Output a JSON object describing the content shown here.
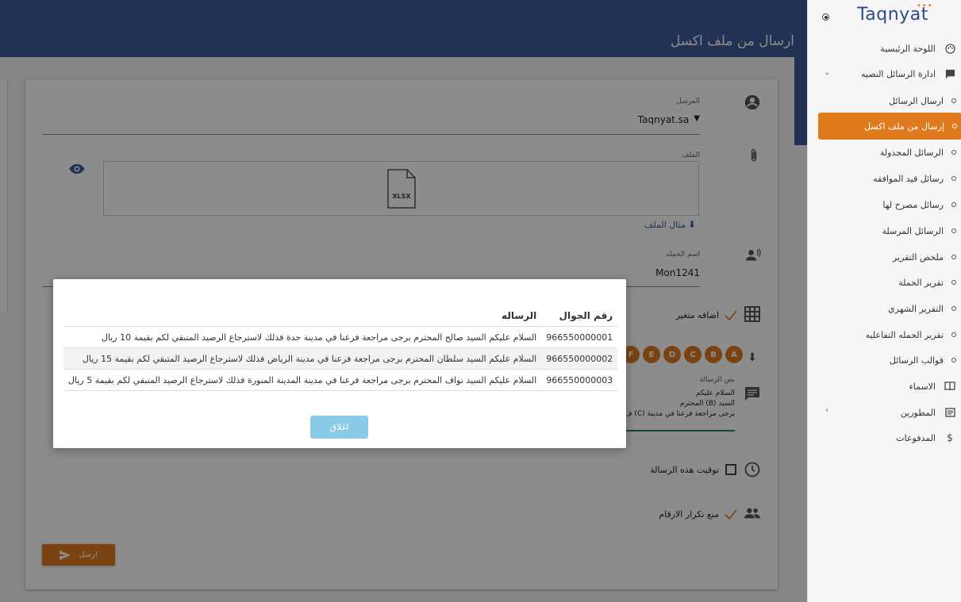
{
  "page": {
    "title": "ارسال من ملف اكسل"
  },
  "form": {
    "sender_label": "المرسل",
    "sender_value": "Taqnyat.sa",
    "file_label": "الملف",
    "file_type": "XLSX",
    "example_link": "مثال الملف",
    "campaign_label": "اسم الحمله",
    "campaign_value": "Mon1241",
    "add_variable": "اضافه متغير",
    "variables": [
      "A",
      "B",
      "C",
      "D",
      "E",
      "F"
    ],
    "message_label": "نص الرسالة",
    "message_lines": [
      "السلام عليكم",
      "السيد (B) المحترم",
      "يرجى مراجعة فرعنا في مدينة  (C) ف"
    ],
    "schedule_label": "توقيت هذه الرسالة",
    "dedupe_label": "منع تكرار الارقام",
    "send_label": "ارسل"
  },
  "dialog": {
    "col_phone": "رقم الجوال",
    "col_message": "الرساله",
    "rows": [
      {
        "phone": "966550000001",
        "message": "السلام عليكم السيد صالح المحترم برجى مراجعة فرعنا في مدينة جدة فذلك لاسترجاع الرصيد المتبقي لكم بقيمة 10 ريال"
      },
      {
        "phone": "966550000002",
        "message": "السلام عليكم السيد سلطان المحترم برجى مراجعة فرعنا في مدينة الرياض فذلك لاسترجاع الرصيد المتبقي لكم بقيمة 15 ريال"
      },
      {
        "phone": "966550000003",
        "message": "السلام عليكم السيد نواف المحترم برجى مراجعة فرعنا في مدينة المدينة المنورة فذلك لاسترجاع الرصيد المتبقي لكم بقيمة 5 ريال"
      }
    ],
    "close_label": "اغلاق"
  },
  "sidebar": {
    "brand": "Taqnyat",
    "items": [
      {
        "label": "اللوحة الرئيسية",
        "icon": "palette-icon"
      },
      {
        "label": "ادارة الرسائل النصيه",
        "icon": "message-icon"
      },
      {
        "label": "ارسال الرسائل",
        "icon": "bullet"
      },
      {
        "label": "إرسال من ملف اكسل",
        "icon": "bullet"
      },
      {
        "label": "الرسائل المجدولة",
        "icon": "bullet"
      },
      {
        "label": "رسائل قيد الموافقه",
        "icon": "bullet"
      },
      {
        "label": "رسائل مصرح لها",
        "icon": "bullet"
      },
      {
        "label": "الرسائل المرسلة",
        "icon": "bullet"
      },
      {
        "label": "ملخص التقرير",
        "icon": "bullet"
      },
      {
        "label": "تقرير الحملة",
        "icon": "bullet"
      },
      {
        "label": "التقرير الشهري",
        "icon": "bullet"
      },
      {
        "label": "تقرير الحمله التفاعليه",
        "icon": "bullet"
      },
      {
        "label": "قوالب الرسائل",
        "icon": "bullet"
      },
      {
        "label": "الاسماء",
        "icon": "book-icon"
      },
      {
        "label": "المطورين",
        "icon": "api-icon"
      },
      {
        "label": "المدفوعات",
        "icon": "dollar-icon"
      }
    ]
  },
  "colors": {
    "brand_blue": "#3f5c9a",
    "accent_orange": "#e07a1f",
    "close_button": "#8ccbe8"
  }
}
